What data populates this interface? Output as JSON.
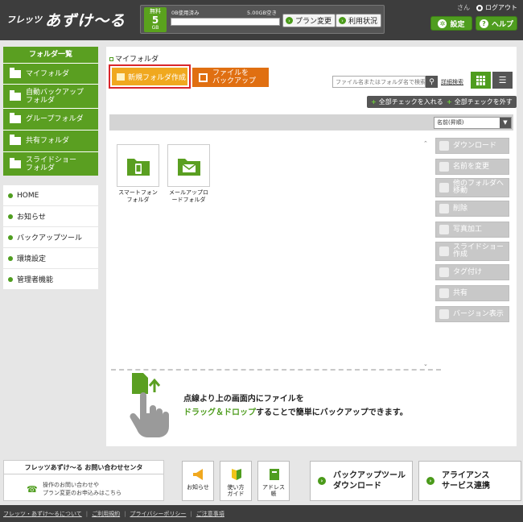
{
  "header": {
    "logo_small": "フレッツ",
    "logo_big": "あずけ〜る",
    "plan": {
      "label": "無料",
      "size": "5",
      "unit": "GB"
    },
    "used_text": "0B使用済み",
    "free_text": "5.00GB空き",
    "usage_fraction": 0.0,
    "plan_change": "プラン変更",
    "usage_status": "利用状況",
    "user_suffix": "さん",
    "logout": "ログアウト",
    "settings": "設定",
    "help": "ヘルプ"
  },
  "sidebar": {
    "folder_heading": "フォルダ一覧",
    "folders": [
      {
        "label": "マイフォルダ"
      },
      {
        "label": "自動バックアップ\nフォルダ"
      },
      {
        "label": "グループフォルダ"
      },
      {
        "label": "共有フォルダ"
      },
      {
        "label": "スライドショー\nフォルダ"
      }
    ],
    "nav": [
      {
        "label": "HOME"
      },
      {
        "label": "お知らせ"
      },
      {
        "label": "バックアップツール"
      },
      {
        "label": "環境設定"
      },
      {
        "label": "管理者機能"
      }
    ]
  },
  "main": {
    "breadcrumb": "マイフォルダ",
    "new_folder": "新規フォルダ作成",
    "backup_files": "ファイルを\nバックアップ",
    "search_placeholder": "ファイル名またはフォルダ名で検索",
    "advanced_search": "詳細検索",
    "check_all": "全部チェックを入れる",
    "uncheck_all": "全部チェックを外す",
    "sort_value": "名前(昇順)",
    "files": [
      {
        "name": "スマートフォンフォルダ",
        "icon": "smartphone-folder-icon"
      },
      {
        "name": "メールアップロードフォルダ",
        "icon": "mail-folder-icon"
      }
    ],
    "actions": [
      {
        "label": "ダウンロード",
        "icon": "download-icon"
      },
      {
        "label": "名前を変更",
        "icon": "pencil-icon"
      },
      {
        "label": "他のフォルダへ\n移動",
        "icon": "move-folder-icon"
      },
      {
        "label": "削除",
        "icon": "trash-icon"
      },
      {
        "label": "写真加工",
        "icon": "camera-icon"
      },
      {
        "label": "スライドショー\n作成",
        "icon": "slideshow-icon"
      },
      {
        "label": "タグ付け",
        "icon": "tag-icon"
      },
      {
        "label": "共有",
        "icon": "share-icon"
      },
      {
        "label": "バージョン表示",
        "icon": "version-icon"
      }
    ],
    "drop_line1": "点線より上の画面内にファイルを",
    "drop_line2_green": "ドラッグ＆ドロップ",
    "drop_line2_rest": "することで簡単にバックアップできます。"
  },
  "footer": {
    "contact_title": "フレッツあずけ〜る お問い合わせセンタ",
    "contact_desc1": "操作のお問い合わせや",
    "contact_desc2": "プラン変更のお申込みはこちら",
    "tiles": [
      {
        "label": "お知らせ",
        "icon": "megaphone-icon"
      },
      {
        "label": "使い方\nガイド",
        "icon": "beginner-mark-icon"
      },
      {
        "label": "アドレス\n帳",
        "icon": "address-book-icon"
      }
    ],
    "backup_tool_download": "バックアップツール\nダウンロード",
    "alliance": "アライアンス\nサービス連携",
    "links": [
      "フレッツ・あずけ〜るについて",
      "ご利用規約",
      "プライバシーポリシー",
      "ご注意事項"
    ]
  },
  "colors": {
    "green": "#5a9f21",
    "orange": "#e06f11",
    "yellow": "#f0a81f",
    "highlight": "#d9262b",
    "header": "#3d3d3d"
  }
}
